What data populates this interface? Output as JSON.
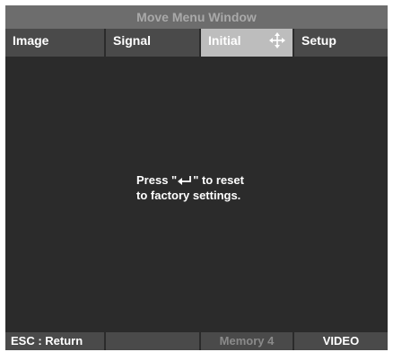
{
  "window": {
    "title": "Move Menu Window"
  },
  "tabs": [
    {
      "label": "Image",
      "active": false
    },
    {
      "label": "Signal",
      "active": false
    },
    {
      "label": "Initial",
      "active": true
    },
    {
      "label": "Setup",
      "active": false
    }
  ],
  "content": {
    "message_line1_prefix": "Press \"",
    "message_line1_suffix": "\" to reset",
    "message_line2": "to factory settings.",
    "enter_icon": "enter-return-icon"
  },
  "footer": {
    "esc_label": "ESC : Return",
    "memory_label": "Memory 4",
    "source_label": "VIDEO"
  },
  "colors": {
    "background": "#2b2b2b",
    "title_bar": "#6d6d6d",
    "tab_normal": "#4a4a4a",
    "tab_active": "#bdbdbd",
    "text": "#ffffff",
    "disabled_text": "#8a8a8a"
  }
}
